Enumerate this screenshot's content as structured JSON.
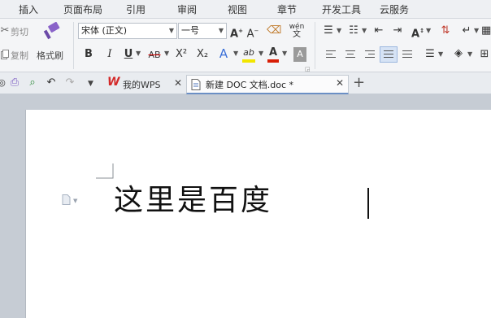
{
  "menu": {
    "tabs": [
      "插入",
      "页面布局",
      "引用",
      "审阅",
      "视图",
      "章节",
      "开发工具",
      "云服务"
    ]
  },
  "ribbon": {
    "cut_label": "剪切",
    "copy_label": "复制",
    "format_painter_label": "格式刷",
    "font_name": "宋体 (正文)",
    "font_size": "一号",
    "bold": "B",
    "italic": "I",
    "underline": "U",
    "strike": "AB",
    "superscript": "X²",
    "subscript": "X₂",
    "text_effect": "A",
    "highlight": "ab",
    "font_color": "A",
    "char_shading": "A",
    "pinyin": "wén",
    "highlight_color": "#f2e600",
    "font_color_value": "#d81e06"
  },
  "tabs": {
    "home_label": "我的WPS",
    "doc_label": "新建 DOC 文档.doc *"
  },
  "document": {
    "text": "这里是百度"
  }
}
